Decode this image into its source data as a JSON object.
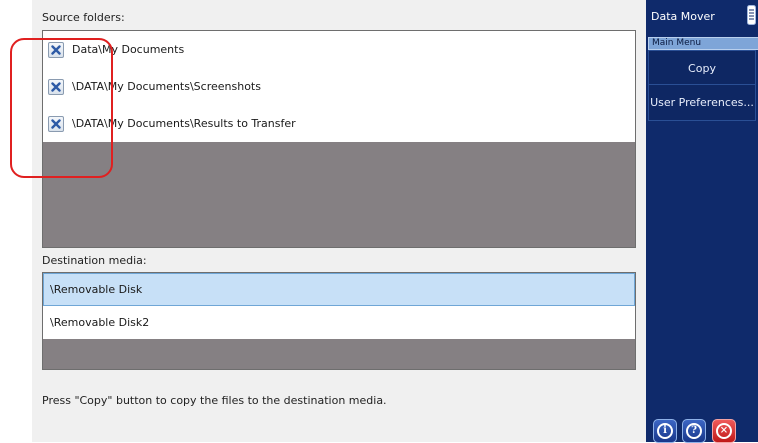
{
  "main": {
    "source_label": "Source folders:",
    "sources": [
      {
        "checked": true,
        "path": "Data\\My Documents"
      },
      {
        "checked": true,
        "path": "\\DATA\\My Documents\\Screenshots"
      },
      {
        "checked": true,
        "path": "\\DATA\\My Documents\\Results to Transfer"
      }
    ],
    "destination_label": "Destination media:",
    "destinations": [
      {
        "label": "\\Removable Disk",
        "selected": true
      },
      {
        "label": "\\Removable Disk2",
        "selected": false
      }
    ],
    "footer_message": "Press \"Copy\" button to copy the files to the destination media."
  },
  "sidebar": {
    "app_title": "Data Mover",
    "menu_header": "Main Menu",
    "buttons": [
      {
        "label": "Copy"
      },
      {
        "label": "User Preferences..."
      }
    ],
    "bottom_buttons": [
      {
        "icon": "info-icon",
        "glyph": "i"
      },
      {
        "icon": "help-icon",
        "glyph": "?"
      },
      {
        "icon": "close-icon",
        "glyph": "×"
      }
    ]
  },
  "colors": {
    "sidebar_bg": "#0f2a6b",
    "selection": "#c7e0f7",
    "empty_list": "#858083",
    "annotation": "#e02020"
  }
}
